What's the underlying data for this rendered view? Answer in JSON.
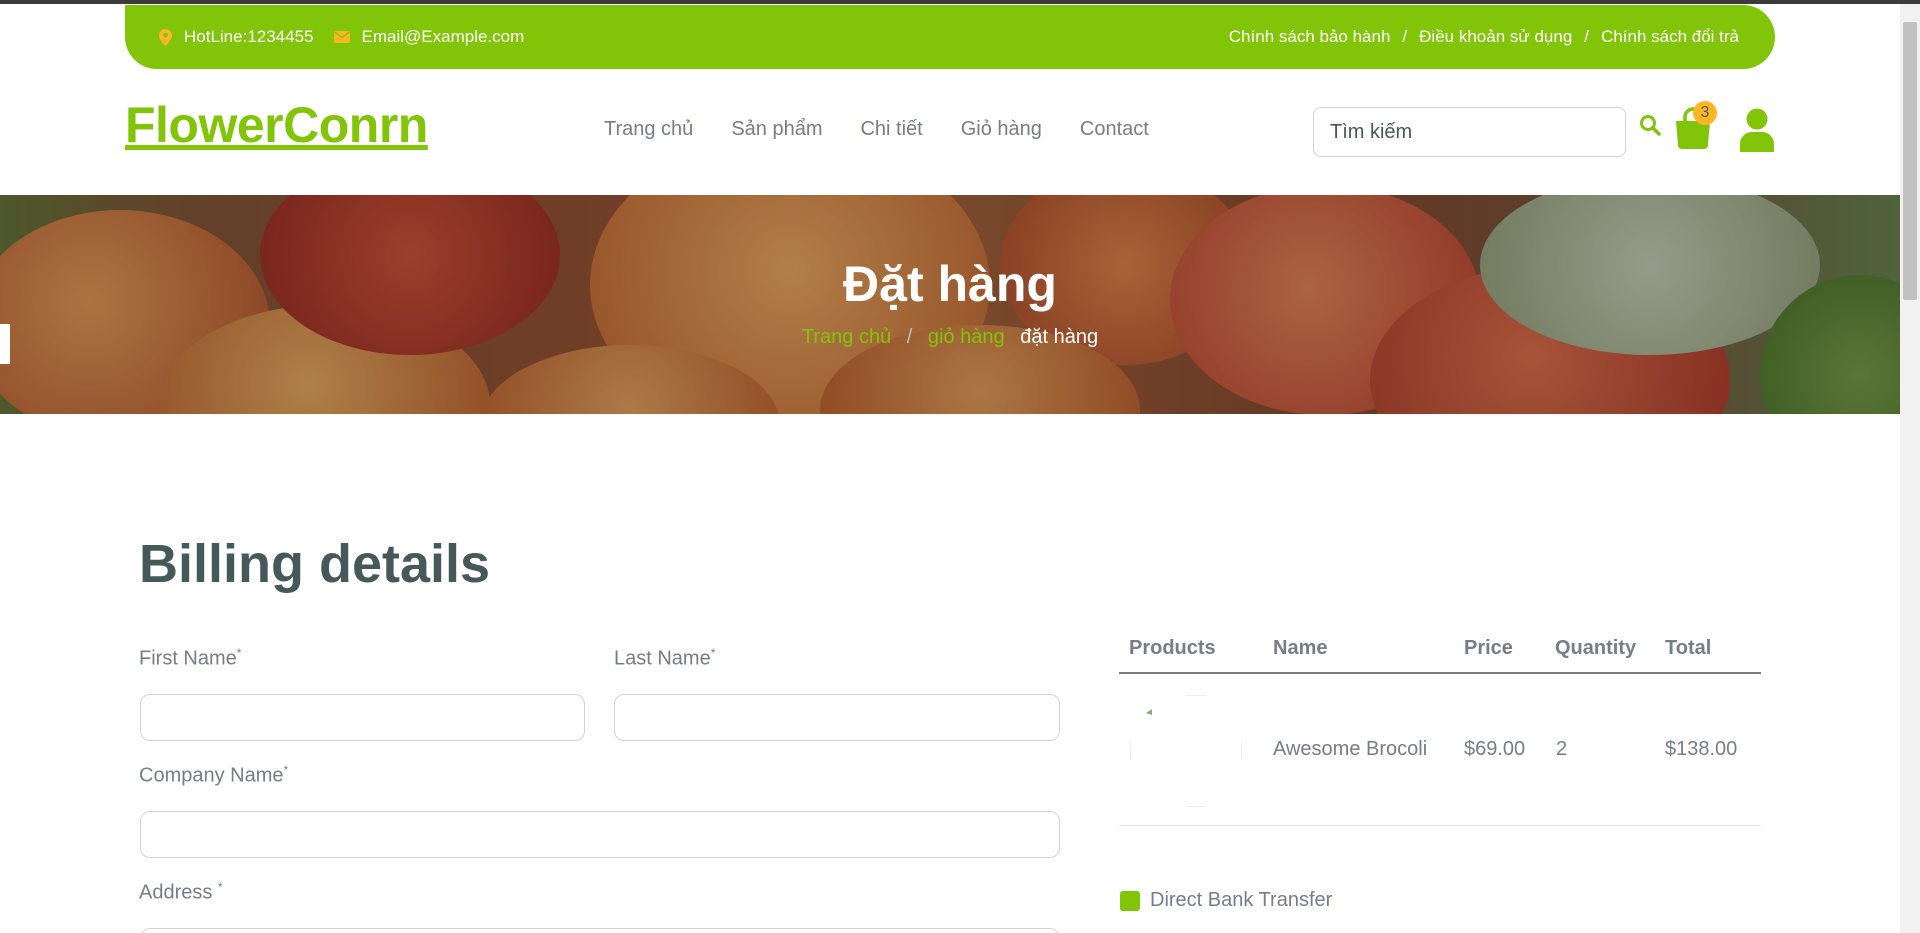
{
  "topbar": {
    "hotline": "HotLine:1234455",
    "email": "Email@Example.com",
    "links": [
      "Chính sách bảo hành",
      "Điều khoản sử dụng",
      "Chính sách đổi trả"
    ],
    "separator": "/"
  },
  "header": {
    "logo": "FlowerConrn",
    "nav": [
      "Trang chủ",
      "Sản phẩm",
      "Chi tiết",
      "Giỏ hàng",
      "Contact"
    ],
    "search_placeholder": "Tìm kiếm",
    "cart_count": "3"
  },
  "hero": {
    "title": "Đặt hàng",
    "breadcrumb": [
      "Trang chủ",
      "giỏ hàng",
      "đặt hàng"
    ],
    "separator": "/"
  },
  "billing": {
    "title": "Billing details",
    "first_name": "First Name",
    "last_name": "Last Name",
    "company_name": "Company Name",
    "address": "Address ",
    "required_mark": "*"
  },
  "order": {
    "headers": [
      "Products",
      "Name",
      "Price",
      "Quantity",
      "Total"
    ],
    "rows": [
      {
        "name": "Awesome Brocoli",
        "price": "$69.00",
        "quantity": "2",
        "total": "$138.00"
      }
    ],
    "payment_option": "Direct Bank Transfer"
  },
  "colors": {
    "primary": "#81c408",
    "secondary": "#ffb524",
    "heading": "#45595b",
    "text": "#747d88"
  }
}
